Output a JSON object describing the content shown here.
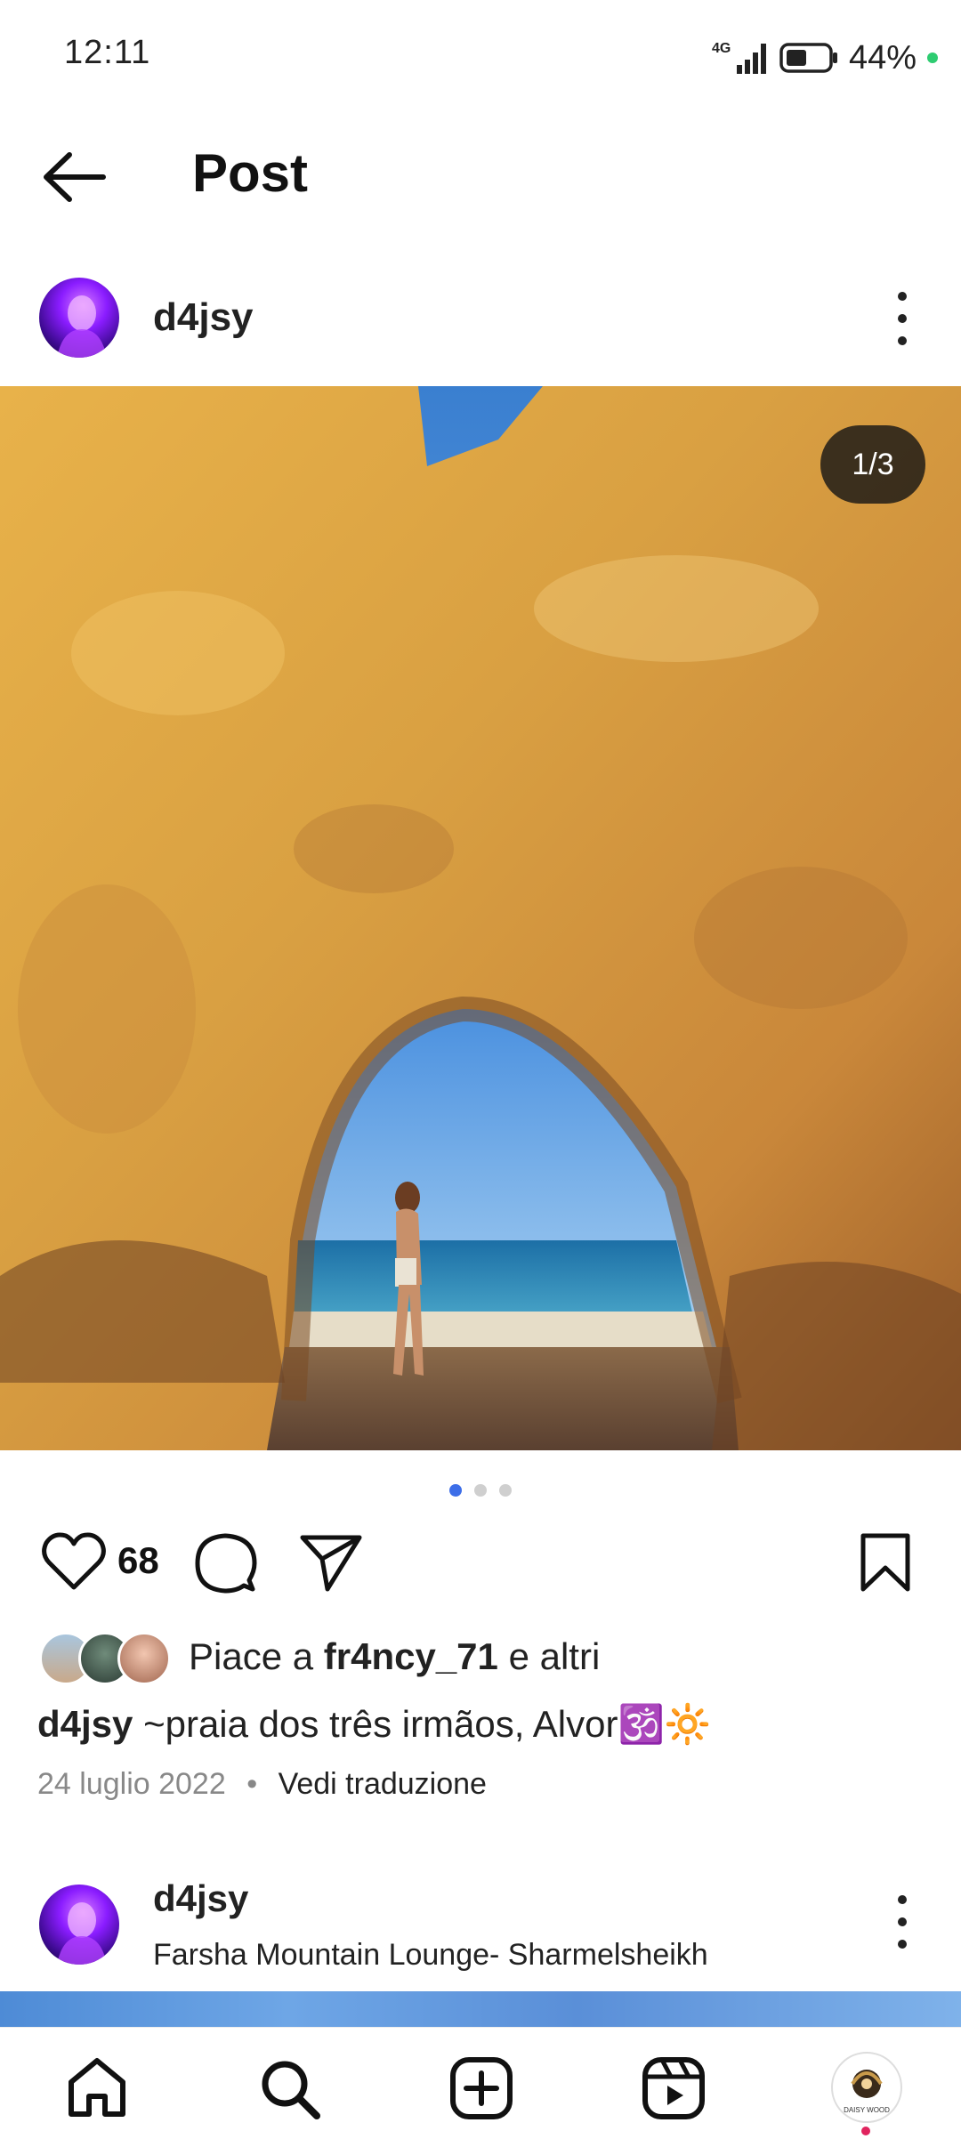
{
  "status_bar": {
    "time": "12:11",
    "network": "4G",
    "battery": "44%"
  },
  "header": {
    "title": "Post"
  },
  "post": {
    "username": "d4jsy",
    "image_counter": "1/3",
    "slide_count": 3,
    "active_slide": 1,
    "likes": "68",
    "liked_by_prefix": "Piace a",
    "liked_by_user": "fr4ncy_71",
    "liked_by_suffix": "e altri",
    "caption_user": "d4jsy",
    "caption_text": " ~praia dos três irmãos, Alvor🕉️🔆",
    "date": "24 luglio 2022",
    "translate": "Vedi traduzione"
  },
  "next_post": {
    "username": "d4jsy",
    "location": "Farsha Mountain Lounge- Sharmelsheikh"
  },
  "bottom_nav": {
    "items": [
      "home-icon",
      "search-icon",
      "create-icon",
      "reels-icon",
      "profile-avatar"
    ],
    "profile_label": "DAISY WOOD"
  },
  "colors": {
    "accent_dot": "#3d6ee8",
    "notification": "#e0245e",
    "status_green": "#2ecc71"
  }
}
